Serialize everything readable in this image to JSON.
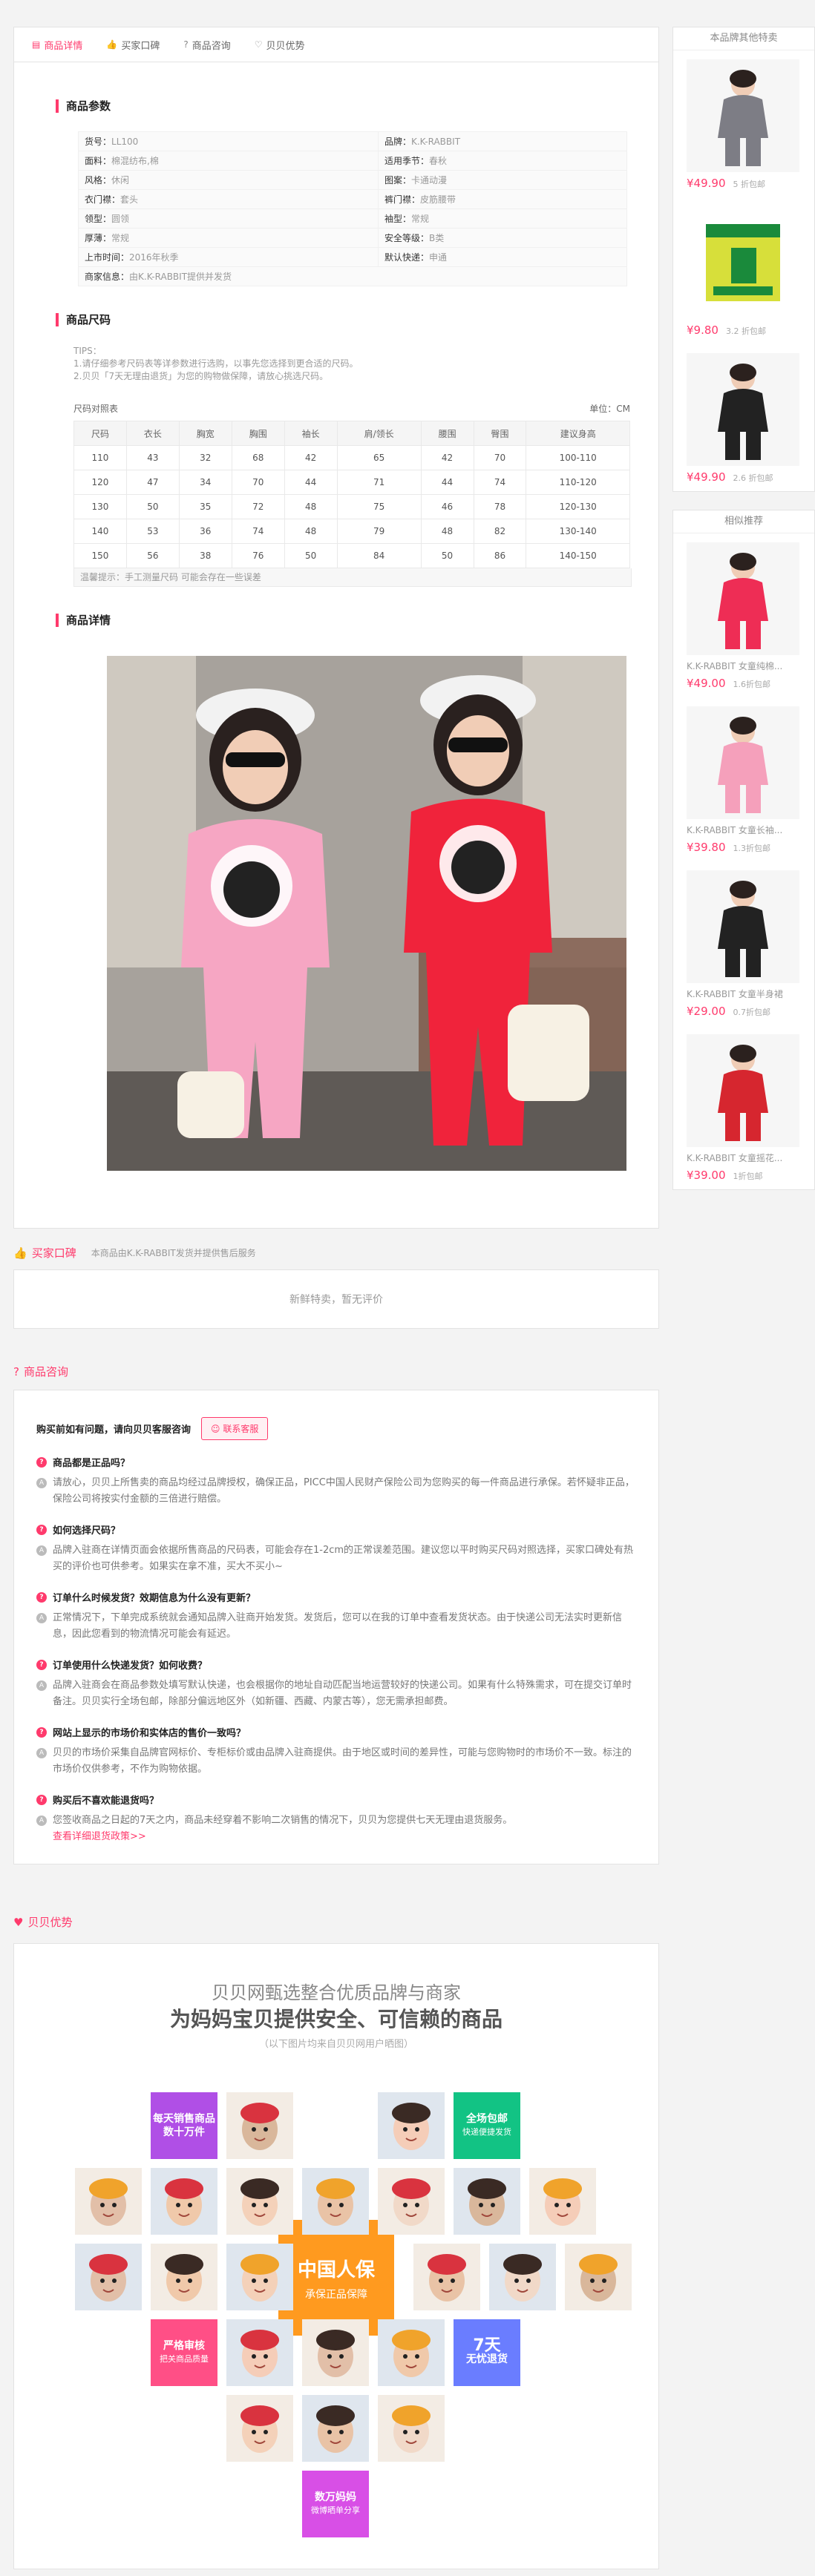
{
  "tabs": [
    {
      "label": "商品详情",
      "icon": "document-icon"
    },
    {
      "label": "买家口碑",
      "icon": "thumbs-up-icon"
    },
    {
      "label": "商品咨询",
      "icon": "question-icon"
    },
    {
      "label": "贝贝优势",
      "icon": "heart-icon"
    }
  ],
  "params": {
    "title": "商品参数",
    "rows": [
      [
        {
          "k": "货号：",
          "v": "LL100"
        },
        {
          "k": "品牌：",
          "v": "K.K-RABBIT"
        }
      ],
      [
        {
          "k": "面料：",
          "v": "棉混纺布,棉"
        },
        {
          "k": "适用季节：",
          "v": "春秋"
        }
      ],
      [
        {
          "k": "风格：",
          "v": "休闲"
        },
        {
          "k": "图案：",
          "v": "卡通动漫"
        }
      ],
      [
        {
          "k": "衣门襟：",
          "v": "套头"
        },
        {
          "k": "裤门襟：",
          "v": "皮筋腰带"
        }
      ],
      [
        {
          "k": "领型：",
          "v": "圆领"
        },
        {
          "k": "袖型：",
          "v": "常规"
        }
      ],
      [
        {
          "k": "厚薄：",
          "v": "常规"
        },
        {
          "k": "安全等级：",
          "v": "B类"
        }
      ],
      [
        {
          "k": "上市时间：",
          "v": "2016年秋季"
        },
        {
          "k": "默认快递：",
          "v": "申通"
        }
      ],
      [
        {
          "k": "商家信息：",
          "v": "由K.K-RABBIT提供并发货"
        }
      ]
    ]
  },
  "sizes": {
    "title": "商品尺码",
    "tips": [
      "TIPS：",
      "1.请仔细参考尺码表等详参数进行选购，以事先您选择到更合适的尺码。",
      "2.贝贝「7天无理由退货」为您的购物做保障，请放心挑选尺码。"
    ],
    "table_label": "尺码对照表",
    "unit": "单位：CM",
    "headers": [
      "尺码",
      "衣长",
      "胸宽",
      "胸围",
      "袖长",
      "肩/领长",
      "腰围",
      "臀围",
      "建议身高"
    ],
    "rows": [
      [
        "110",
        "43",
        "32",
        "68",
        "42",
        "65",
        "42",
        "70",
        "100-110"
      ],
      [
        "120",
        "47",
        "34",
        "70",
        "44",
        "71",
        "44",
        "74",
        "110-120"
      ],
      [
        "130",
        "50",
        "35",
        "72",
        "48",
        "75",
        "46",
        "78",
        "120-130"
      ],
      [
        "140",
        "53",
        "36",
        "74",
        "48",
        "79",
        "48",
        "82",
        "130-140"
      ],
      [
        "150",
        "56",
        "38",
        "76",
        "50",
        "84",
        "50",
        "86",
        "140-150"
      ]
    ],
    "note": "温馨提示：手工测量尺码 可能会存在一些误差"
  },
  "details_title": "商品详情",
  "reviews": {
    "title": "买家口碑",
    "sub": "本商品由K.K-RABBIT发货并提供售后服务",
    "empty": "新鲜特卖，暂无评价"
  },
  "consult": {
    "title": "商品咨询",
    "head": "购买前如有问题，请向贝贝客服咨询",
    "btn": "联系客服",
    "items": [
      {
        "q": "商品都是正品吗？",
        "a": "请放心，贝贝上所售卖的商品均经过品牌授权，确保正品，PICC中国人民财产保险公司为您购买的每一件商品进行承保。若怀疑非正品，保险公司将按实付金额的三倍进行赔偿。"
      },
      {
        "q": "如何选择尺码？",
        "a": "品牌入驻商在详情页面会依据所售商品的尺码表，可能会存在1-2cm的正常误差范围。建议您以平时购买尺码对照选择，买家口碑处有热买的评价也可供参考。如果实在拿不准，买大不买小~"
      },
      {
        "q": "订单什么时候发货？效期信息为什么没有更新？",
        "a": "正常情况下，下单完成系统就会通知品牌入驻商开始发货。发货后，您可以在我的订单中查看发货状态。由于快递公司无法实时更新信息，因此您看到的物流情况可能会有延迟。"
      },
      {
        "q": "订单使用什么快递发货？如何收费？",
        "a": "品牌入驻商会在商品参数处填写默认快递，也会根据你的地址自动匹配当地运营较好的快递公司。如果有什么特殊需求，可在提交订单时备注。贝贝实行全场包邮，除部分偏远地区外（如新疆、西藏、内蒙古等），您无需承担邮费。"
      },
      {
        "q": "网站上显示的市场价和实体店的售价一致吗？",
        "a": "贝贝的市场价采集自品牌官网标价、专柜标价或由品牌入驻商提供。由于地区或时间的差异性，可能与您购物时的市场价不一致。标注的市场价仅供参考，不作为购物依据。"
      },
      {
        "q": "购买后不喜欢能退货吗？",
        "a": "您签收商品之日起的7天之内，商品未经穿着不影响二次销售的情况下，贝贝为您提供七天无理由退货服务。",
        "link": "查看详细退货政策>>"
      }
    ]
  },
  "advantage": {
    "title": "贝贝优势",
    "line1": "贝贝网甄选整合优质品牌与商家",
    "line2": "为妈妈宝贝提供安全、可信赖的商品",
    "note": "（以下图片均来自贝贝网用户晒图）",
    "t1": {
      "b": "每天销售商品",
      "s": "数十万件"
    },
    "t2": {
      "b": "全场包邮",
      "s": "快递便捷发货"
    },
    "t3": {
      "b": "严格审核",
      "s": "把关商品质量"
    },
    "t4": {
      "b": "7天",
      "s": "无忧退货"
    },
    "t5": {
      "b": "数万妈妈",
      "s": "微博晒单分享"
    },
    "center": {
      "b": "中国人保",
      "s": "承保正品保障"
    },
    "colors": {
      "purple": "#b04fe6",
      "green": "#12c384",
      "pink": "#ff4f86",
      "blue": "#6a7dff",
      "magenta": "#d84fe6",
      "orange": "#ff9a1f"
    }
  },
  "side": {
    "brand_title": "本品牌其他特卖",
    "brand_items": [
      {
        "price": "¥49.90",
        "disc": "5 折包邮"
      },
      {
        "price": "¥9.80",
        "disc": "3.2 折包邮"
      },
      {
        "price": "¥49.90",
        "disc": "2.6 折包邮"
      }
    ],
    "rec_title": "相似推荐",
    "rec_items": [
      {
        "name": "K.K-RABBIT 女童纯棉...",
        "price": "¥49.00",
        "disc": "1.6折包邮"
      },
      {
        "name": "K.K-RABBIT 女童长袖...",
        "price": "¥39.80",
        "disc": "1.3折包邮"
      },
      {
        "name": "K.K-RABBIT 女童半身裙",
        "price": "¥29.00",
        "disc": "0.7折包邮"
      },
      {
        "name": "K.K-RABBIT 女童摇花...",
        "price": "¥39.00",
        "disc": "1折包邮"
      }
    ]
  }
}
